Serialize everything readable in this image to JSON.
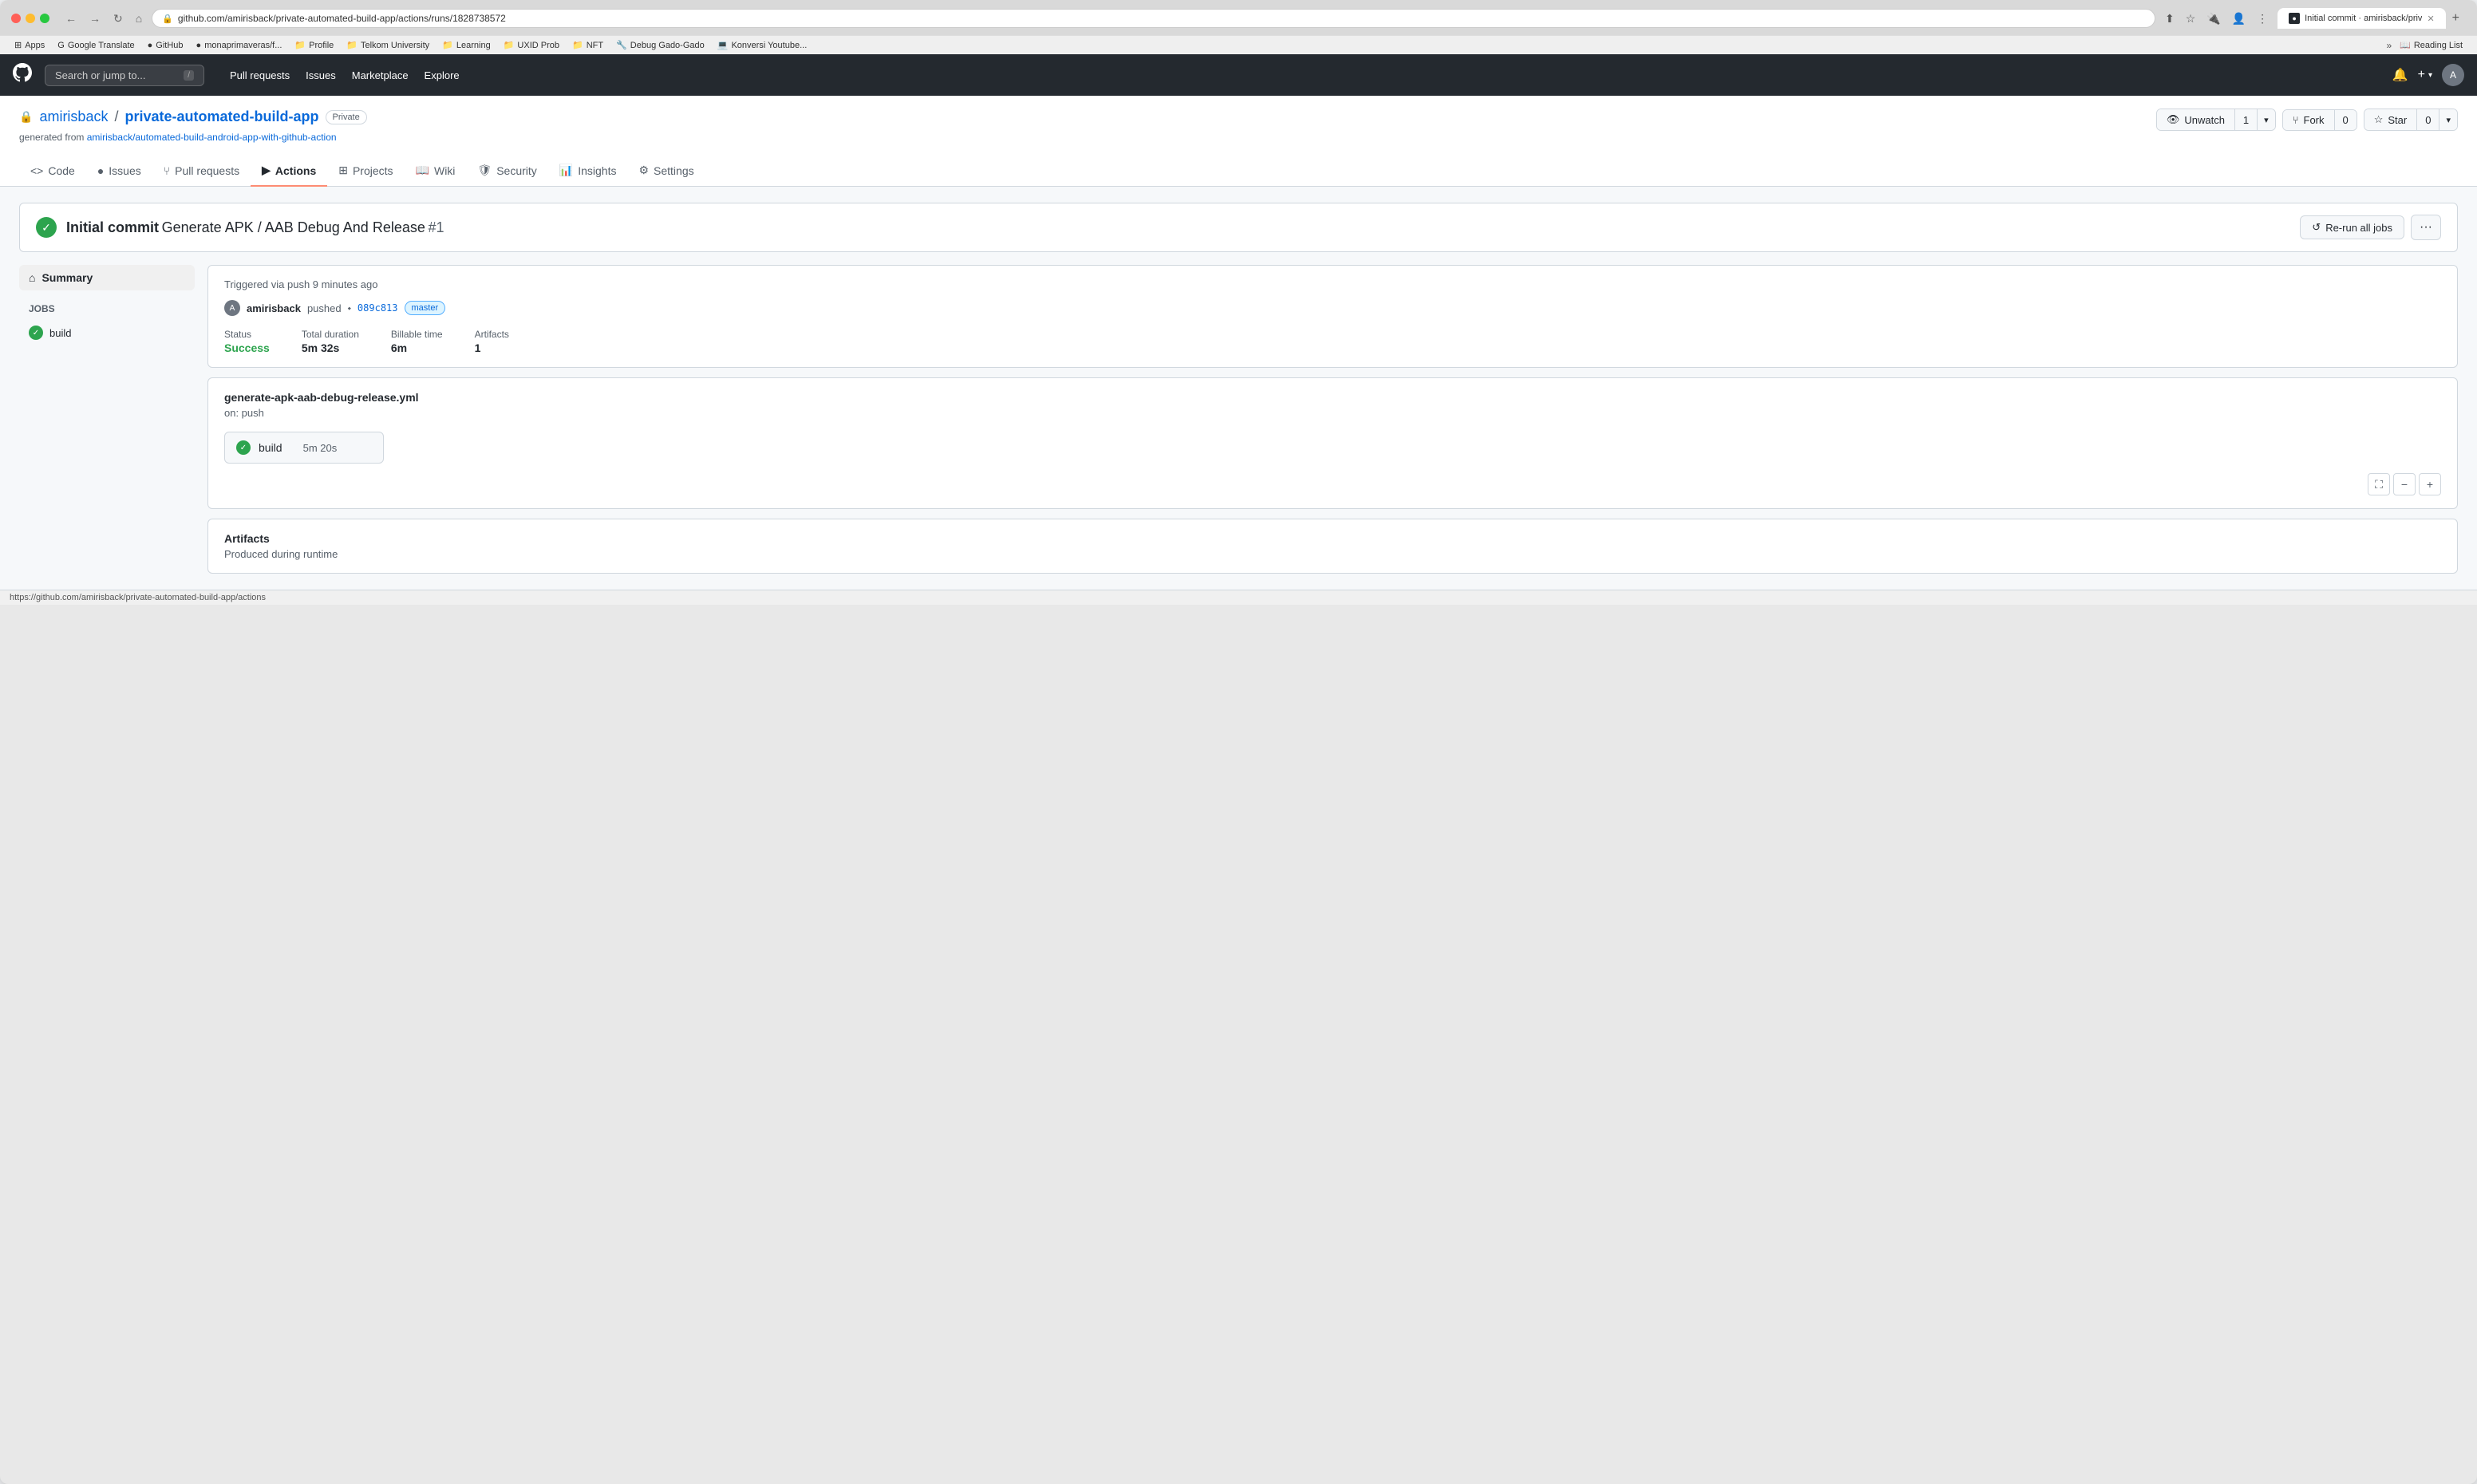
{
  "browser": {
    "tab_title": "Initial commit · amirisback/priv",
    "url": "github.com/amirisback/private-automated-build-app/actions/runs/1828738572",
    "tab_plus": "+",
    "nav_back": "←",
    "nav_forward": "→",
    "nav_refresh": "↻",
    "nav_home": "⌂"
  },
  "bookmarks": {
    "items": [
      {
        "label": "Apps",
        "icon": "⊞"
      },
      {
        "label": "Google Translate",
        "icon": "🔍"
      },
      {
        "label": "GitHub",
        "icon": "●"
      },
      {
        "label": "monaprimaveras/f...",
        "icon": "●"
      },
      {
        "label": "Profile",
        "icon": "📁"
      },
      {
        "label": "Telkom University",
        "icon": "📁"
      },
      {
        "label": "Learning",
        "icon": "📁"
      },
      {
        "label": "UXID Prob",
        "icon": "📁"
      },
      {
        "label": "NFT",
        "icon": "📁"
      },
      {
        "label": "Debug Gado-Gado",
        "icon": "🔧"
      },
      {
        "label": "Konversi Youtube...",
        "icon": "💻"
      },
      {
        "label": "Reading List",
        "icon": "📖"
      }
    ]
  },
  "github": {
    "search_placeholder": "Search or jump to...",
    "search_kbd": "/",
    "nav_items": [
      "Pull requests",
      "Issues",
      "Marketplace",
      "Explore"
    ],
    "notification_icon": "🔔",
    "plus_icon": "+",
    "repo": {
      "owner": "amirisback",
      "separator": "/",
      "name": "private-automated-build-app",
      "badge": "Private",
      "generated_from_text": "generated from",
      "generated_from_link": "amirisback/automated-build-android-app-with-github-action"
    },
    "repo_actions": {
      "watch_icon": "👁",
      "watch_label": "Unwatch",
      "watch_count": "1",
      "fork_icon": "⑂",
      "fork_label": "Fork",
      "fork_count": "0",
      "star_icon": "☆",
      "star_label": "Star",
      "star_count": "0"
    },
    "tabs": [
      {
        "id": "code",
        "icon": "<>",
        "label": "Code",
        "active": false
      },
      {
        "id": "issues",
        "icon": "●",
        "label": "Issues",
        "active": false
      },
      {
        "id": "pull-requests",
        "icon": "⑂",
        "label": "Pull requests",
        "active": false
      },
      {
        "id": "actions",
        "icon": "▶",
        "label": "Actions",
        "active": true
      },
      {
        "id": "projects",
        "icon": "⊞",
        "label": "Projects",
        "active": false
      },
      {
        "id": "wiki",
        "icon": "📖",
        "label": "Wiki",
        "active": false
      },
      {
        "id": "security",
        "icon": "🛡",
        "label": "Security",
        "active": false
      },
      {
        "id": "insights",
        "icon": "📊",
        "label": "Insights",
        "active": false
      },
      {
        "id": "settings",
        "icon": "⚙",
        "label": "Settings",
        "active": false
      }
    ],
    "workflow_run": {
      "status": "success",
      "commit_message": "Initial commit",
      "workflow_name": "Generate APK / AAB Debug And Release",
      "run_number": "#1",
      "rerun_label": "Re-run all jobs",
      "more_label": "···"
    },
    "sidebar": {
      "summary_label": "Summary",
      "summary_icon": "⌂",
      "jobs_section_label": "Jobs",
      "jobs": [
        {
          "id": "build",
          "label": "build",
          "status": "success"
        }
      ]
    },
    "run_info": {
      "trigger_text": "Triggered via push 9 minutes ago",
      "user_avatar": "A",
      "user_name": "amirisback",
      "action": "pushed",
      "commit_hash": "089c813",
      "branch": "master",
      "status_label": "Status",
      "status_value": "Success",
      "duration_label": "Total duration",
      "duration_value": "5m 32s",
      "billable_label": "Billable time",
      "billable_value": "6m",
      "artifacts_label": "Artifacts",
      "artifacts_value": "1"
    },
    "workflow_file": {
      "filename": "generate-apk-aab-debug-release.yml",
      "trigger": "on: push",
      "jobs": [
        {
          "name": "build",
          "duration": "5m 20s",
          "status": "success"
        }
      ]
    },
    "artifacts_section": {
      "title": "Artifacts",
      "subtitle": "Produced during runtime"
    },
    "zoom_controls": {
      "fullscreen": "⛶",
      "zoom_out": "−",
      "zoom_in": "+"
    }
  },
  "status_bar": {
    "url": "https://github.com/amirisback/private-automated-build-app/actions"
  }
}
